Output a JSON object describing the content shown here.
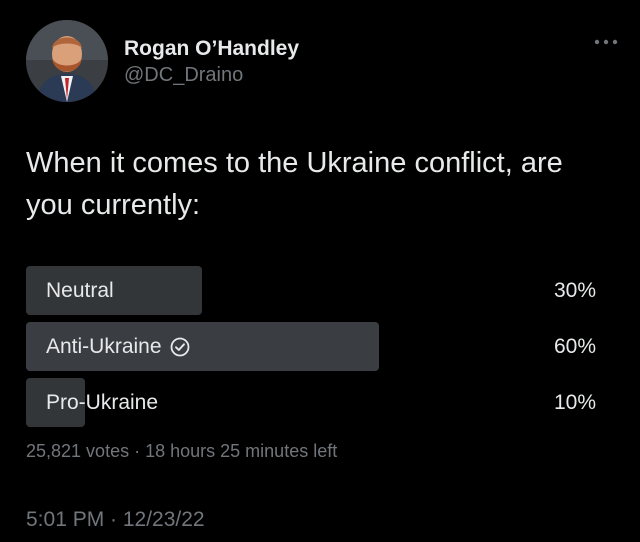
{
  "author": {
    "display_name": "Rogan O’Handley",
    "handle": "@DC_Draino"
  },
  "tweet": {
    "text": "When it comes to the Ukraine conflict, are you currently:"
  },
  "poll": {
    "options": [
      {
        "label": "Neutral",
        "percent_text": "30%",
        "percent": 30,
        "winner": false
      },
      {
        "label": "Anti-Ukraine",
        "percent_text": "60%",
        "percent": 60,
        "winner": true
      },
      {
        "label": "Pro-Ukraine",
        "percent_text": "10%",
        "percent": 10,
        "winner": false
      }
    ],
    "votes": "25,821 votes",
    "separator": "·",
    "time_left": "18 hours 25 minutes left"
  },
  "timestamp": "5:01 PM · 12/23/22",
  "icons": {
    "more": "more-horizontal-icon",
    "winner_check": "check-circle-icon"
  },
  "colors": {
    "background": "#000000",
    "text_primary": "#e7e9ea",
    "text_secondary": "#71767b",
    "poll_bar": "#333639"
  }
}
